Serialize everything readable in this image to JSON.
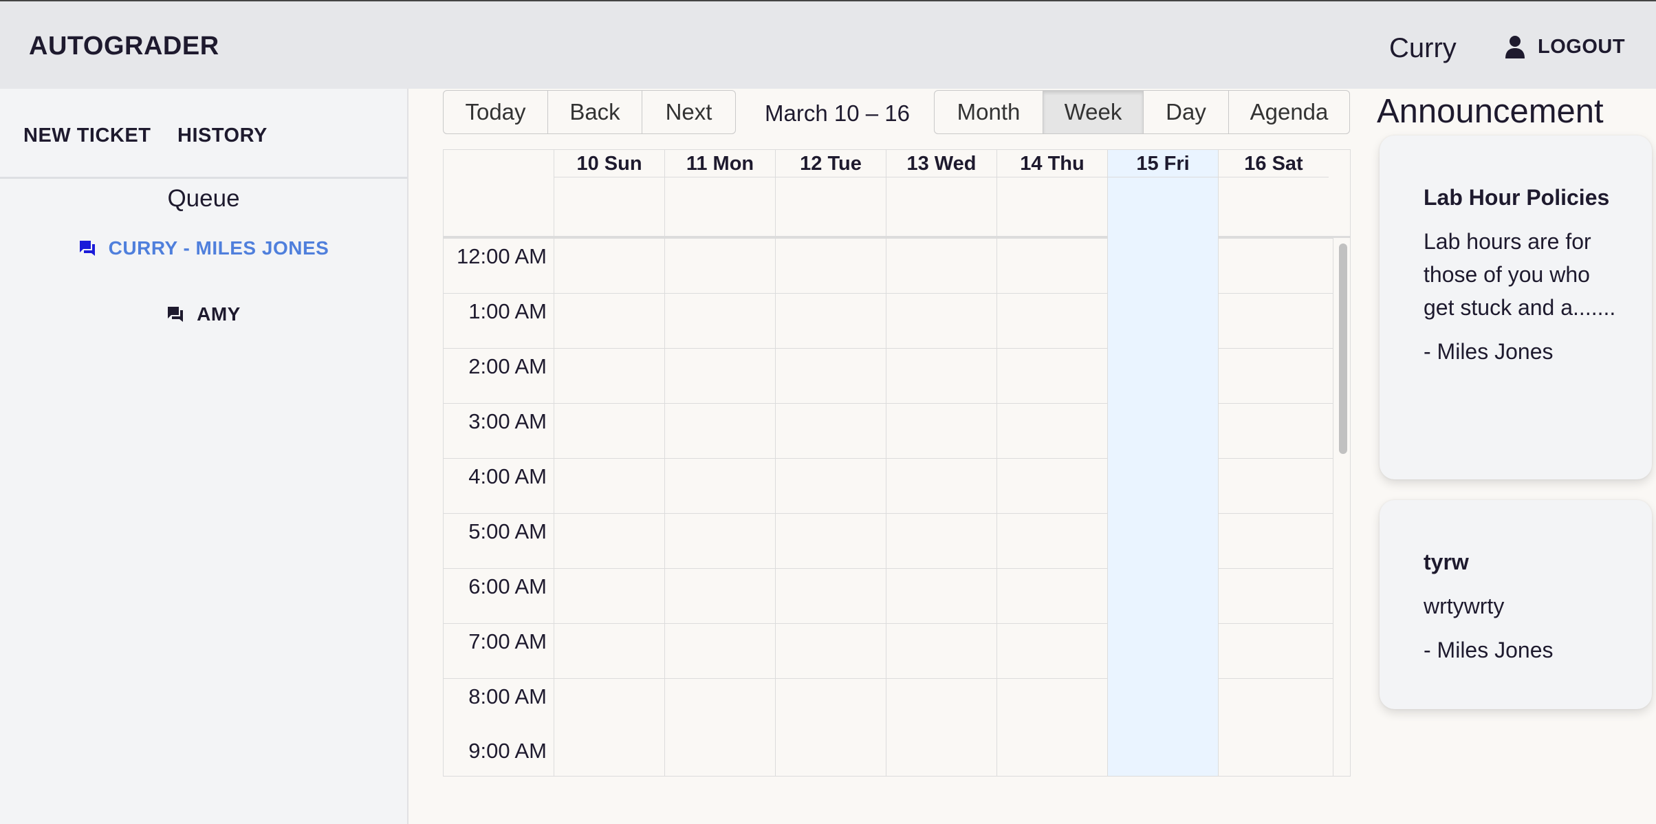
{
  "header": {
    "brand": "AUTOGRADER",
    "username": "Curry",
    "logout_label": "LOGOUT",
    "logout_icon": "person-icon"
  },
  "sidebar": {
    "nav": [
      {
        "label": "NEW TICKET"
      },
      {
        "label": "HISTORY"
      }
    ],
    "queue_title": "Queue",
    "queue": [
      {
        "label": "CURRY - MILES JONES",
        "icon": "chat-icon",
        "active": true
      },
      {
        "label": "AMY",
        "icon": "chat-icon",
        "active": false
      }
    ]
  },
  "calendar": {
    "nav_buttons": [
      "Today",
      "Back",
      "Next"
    ],
    "range_label": "March 10 – 16",
    "view_buttons": [
      "Month",
      "Week",
      "Day",
      "Agenda"
    ],
    "active_view": "Week",
    "days": [
      "10 Sun",
      "11 Mon",
      "12 Tue",
      "13 Wed",
      "14 Thu",
      "15 Fri",
      "16 Sat"
    ],
    "today": "15 Fri",
    "hours": [
      "12:00 AM",
      "1:00 AM",
      "2:00 AM",
      "3:00 AM",
      "4:00 AM",
      "5:00 AM",
      "6:00 AM",
      "7:00 AM",
      "8:00 AM",
      "9:00 AM"
    ],
    "colors": {
      "today_bg": "#eaf4ff",
      "active_queue": "#4f7fdc",
      "chat_icon_active": "#1b1bd9"
    }
  },
  "announcements": {
    "title": "Announcement",
    "items": [
      {
        "title": "Lab Hour Policies",
        "body": "Lab hours are for those of you who get stuck and a.......",
        "author": "- Miles Jones"
      },
      {
        "title": "tyrw",
        "body": "wrtywrty",
        "author": "- Miles Jones"
      }
    ]
  }
}
